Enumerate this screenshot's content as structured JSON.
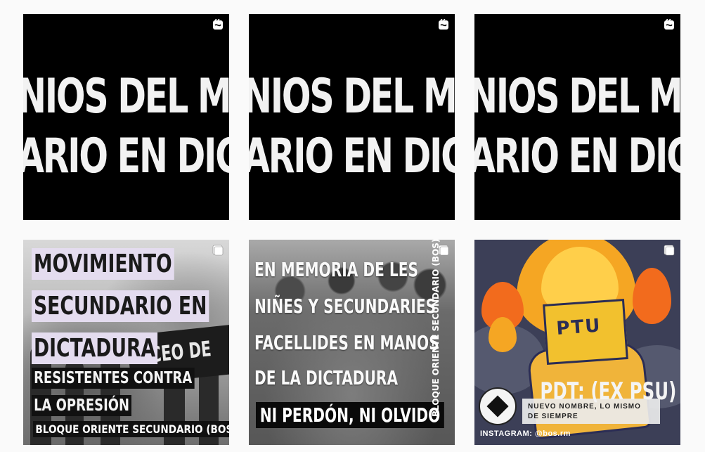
{
  "posts": [
    {
      "type": "reel",
      "line1": "NIOS DEL MOVI",
      "line2": "ARIO EN DICTA",
      "badge": "reel-icon"
    },
    {
      "type": "reel",
      "line1": "NIOS DEL MOVI",
      "line2": "ARIO EN DICTA",
      "badge": "reel-icon"
    },
    {
      "type": "reel",
      "line1": "NIOS DEL MOVI",
      "line2": "ARIO EN DICTA",
      "badge": "reel-icon"
    },
    {
      "type": "carousel",
      "badge": "carousel-icon",
      "lines": [
        "MOVIMIENTO",
        "SECUNDARIO EN",
        "DICTADURA",
        "RESISTENTES CONTRA",
        "LA OPRESIÓN",
        "BLOQUE ORIENTE SECUNDARIO (BOS)"
      ],
      "banner": "LICEO DE"
    },
    {
      "type": "carousel",
      "badge": "carousel-icon",
      "lines": [
        "EN MEMORIA DE LES",
        "NIÑES Y SECUNDARIES",
        "FACELLIDES EN MANOS",
        "DE LA DICTADURA"
      ],
      "slogan": "NI PERDÓN, NI OLVIDO",
      "vertical": "BLOQUE ORIENTE SECUNDARIO (BOS)"
    },
    {
      "type": "carousel",
      "badge": "carousel-icon",
      "paper": "PTU",
      "title": "PDT: (EX PSU)",
      "subtitle1": "NUEVO NOMBRE, LO MISMO",
      "subtitle2": "DE SIEMPRE",
      "instagram": "INSTAGRAM: @bos.rm"
    }
  ],
  "colors": {
    "background": "#fafafa",
    "lilac": "#e4dcef",
    "flame": "#f5a623",
    "paper": "#f2c12e",
    "navy": "#2b2d55"
  }
}
